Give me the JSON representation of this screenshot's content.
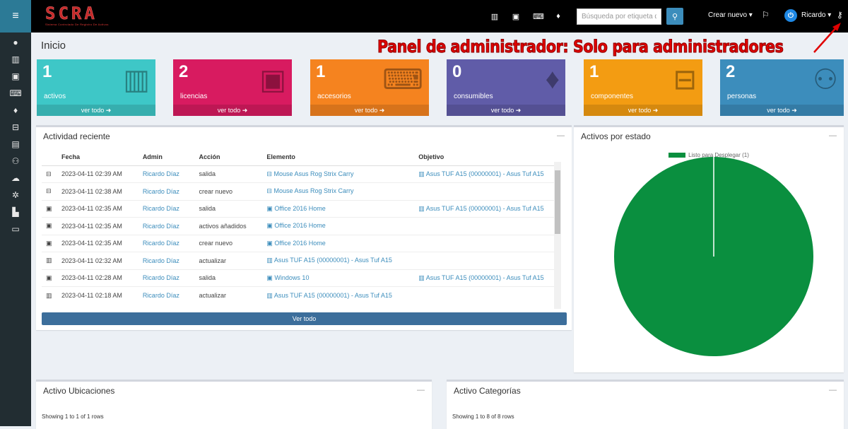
{
  "sidebar": {
    "toggle_icon": "hamburger-icon",
    "items": [
      "dashboard-icon",
      "barcode-icon",
      "save-icon",
      "keyboard-icon",
      "droplet-icon",
      "server-icon",
      "users-icon",
      "users-group-icon",
      "cloud-icon",
      "gear-icon",
      "chart-icon",
      "laptop-icon"
    ]
  },
  "header": {
    "logo_text": "SCRA",
    "logo_tagline": "Sistema Controlado De Registro De Activos",
    "search_placeholder": "Búsqueda por etiqueta de",
    "crear_label": "Crear nuevo ▾",
    "user_label": "Ricardo ▾"
  },
  "page": {
    "title": "Inicio"
  },
  "annotation": {
    "text": "Panel de administrador: Solo para administradores"
  },
  "tiles": [
    {
      "count": "1",
      "label": "activos",
      "footer": "ver todo ➜",
      "color": "#3ec7c7",
      "icon": "barcode-icon"
    },
    {
      "count": "2",
      "label": "licencias",
      "footer": "ver todo ➜",
      "color": "#d81b60",
      "icon": "save-icon"
    },
    {
      "count": "1",
      "label": "accesorios",
      "footer": "ver todo ➜",
      "color": "#f5831f",
      "icon": "keyboard-icon"
    },
    {
      "count": "0",
      "label": "consumibles",
      "footer": "ver todo ➜",
      "color": "#605ca8",
      "icon": "droplet-icon"
    },
    {
      "count": "1",
      "label": "componentes",
      "footer": "ver todo ➜",
      "color": "#f39c12",
      "icon": "server-icon"
    },
    {
      "count": "2",
      "label": "personas",
      "footer": "ver todo ➜",
      "color": "#3c8dbc",
      "icon": "users-icon"
    }
  ],
  "activity": {
    "title": "Actividad reciente",
    "collapse": "—",
    "headers": [
      "Fecha",
      "Admin",
      "Acción",
      "Elemento",
      "Objetivo"
    ],
    "rows": [
      {
        "icon": "⊟",
        "fecha": "2023-04-11 02:39 AM",
        "admin": "Ricardo Díaz",
        "accion": "salida",
        "elemento": "⊟ Mouse Asus Rog Strix Carry",
        "objetivo": "▥ Asus TUF A15 (00000001) - Asus Tuf A15"
      },
      {
        "icon": "⊟",
        "fecha": "2023-04-11 02:38 AM",
        "admin": "Ricardo Díaz",
        "accion": "crear nuevo",
        "elemento": "⊟ Mouse Asus Rog Strix Carry",
        "objetivo": ""
      },
      {
        "icon": "▣",
        "fecha": "2023-04-11 02:35 AM",
        "admin": "Ricardo Díaz",
        "accion": "salida",
        "elemento": "▣ Office 2016 Home",
        "objetivo": "▥ Asus TUF A15 (00000001) - Asus Tuf A15"
      },
      {
        "icon": "▣",
        "fecha": "2023-04-11 02:35 AM",
        "admin": "Ricardo Díaz",
        "accion": "activos añadidos",
        "elemento": "▣ Office 2016 Home",
        "objetivo": ""
      },
      {
        "icon": "▣",
        "fecha": "2023-04-11 02:35 AM",
        "admin": "Ricardo Díaz",
        "accion": "crear nuevo",
        "elemento": "▣ Office 2016 Home",
        "objetivo": ""
      },
      {
        "icon": "▥",
        "fecha": "2023-04-11 02:32 AM",
        "admin": "Ricardo Díaz",
        "accion": "actualizar",
        "elemento": "▥ Asus TUF A15 (00000001) - Asus Tuf A15",
        "objetivo": ""
      },
      {
        "icon": "▣",
        "fecha": "2023-04-11 02:28 AM",
        "admin": "Ricardo Díaz",
        "accion": "salida",
        "elemento": "▣ Windows 10",
        "objetivo": "▥ Asus TUF A15 (00000001) - Asus Tuf A15"
      },
      {
        "icon": "▥",
        "fecha": "2023-04-11 02:18 AM",
        "admin": "Ricardo Díaz",
        "accion": "actualizar",
        "elemento": "▥ Asus TUF A15 (00000001) - Asus Tuf A15",
        "objetivo": ""
      }
    ],
    "ver_todo": "Ver todo"
  },
  "status_chart": {
    "title": "Activos por estado",
    "collapse": "—"
  },
  "chart_data": {
    "type": "pie",
    "title": "",
    "legend": [
      {
        "name": "Listo para Desplegar (1)",
        "color": "#0a8f3f"
      }
    ],
    "slices": [
      {
        "name": "Listo para Desplegar",
        "value": 1,
        "color": "#0a8f3f"
      }
    ]
  },
  "locations": {
    "title": "Activo Ubicaciones",
    "collapse": "—",
    "rows_text": "Showing 1 to 1 of 1 rows"
  },
  "categories": {
    "title": "Activo Categorías",
    "collapse": "—",
    "rows_text": "Showing 1 to 8 of 8 rows"
  }
}
